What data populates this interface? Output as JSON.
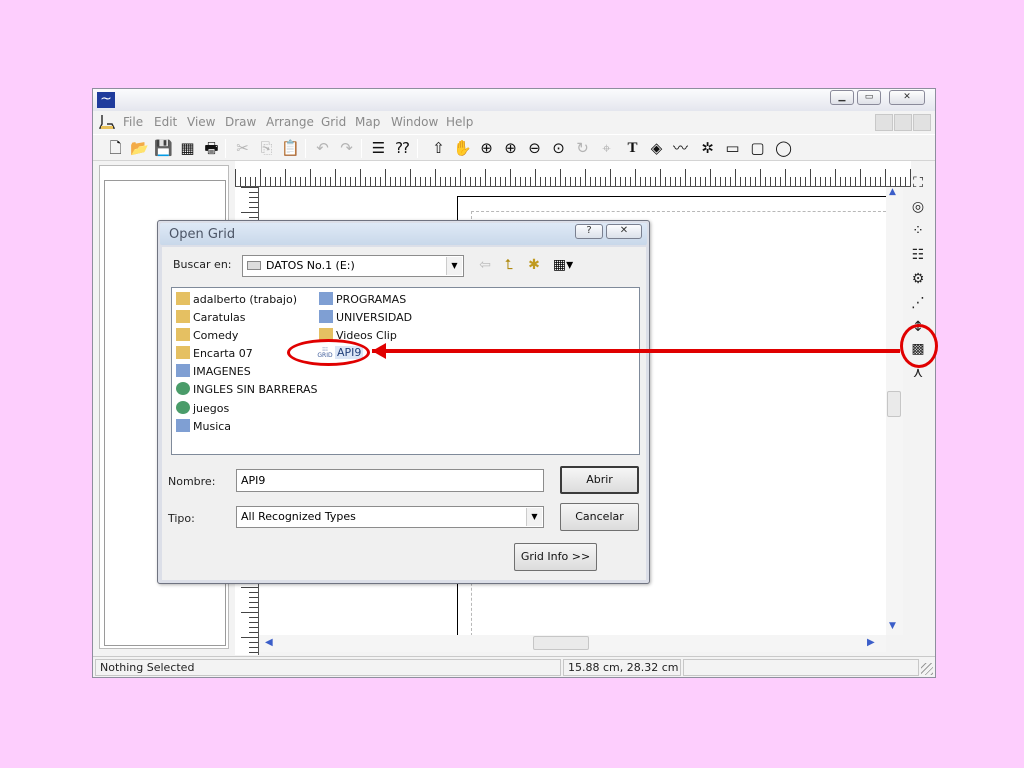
{
  "menu": {
    "items": [
      "File",
      "Edit",
      "View",
      "Draw",
      "Arrange",
      "Grid",
      "Map",
      "Window",
      "Help"
    ]
  },
  "status": {
    "message": "Nothing Selected",
    "coordinates": "15.88 cm, 28.32 cm"
  },
  "dialog": {
    "title": "Open Grid",
    "look_in_label": "Buscar en:",
    "look_in_value": "DATOS No.1 (E:)",
    "files_col1": [
      {
        "name": "adalberto (trabajo)",
        "icon": "folder-icon"
      },
      {
        "name": "Caratulas",
        "icon": "shared-folder-icon"
      },
      {
        "name": "Comedy",
        "icon": "folder-icon"
      },
      {
        "name": "Encarta 07",
        "icon": "folder-icon"
      },
      {
        "name": "IMAGENES",
        "icon": "shortcut-icon"
      },
      {
        "name": "INGLES SIN BARRERAS",
        "icon": "globe-icon"
      },
      {
        "name": "juegos",
        "icon": "globe-icon"
      },
      {
        "name": "Musica",
        "icon": "shortcut-icon"
      }
    ],
    "files_col2": [
      {
        "name": "PROGRAMAS",
        "icon": "shortcut-icon"
      },
      {
        "name": "UNIVERSIDAD",
        "icon": "shortcut-icon"
      },
      {
        "name": "Videos Clip",
        "icon": "folder-icon"
      }
    ],
    "selected_file": {
      "name": "API9",
      "icon_text": "GRID"
    },
    "name_label": "Nombre:",
    "name_value": "API9",
    "type_label": "Tipo:",
    "type_value": "All Recognized Types",
    "open_button": "Abrir",
    "cancel_button": "Cancelar",
    "grid_info_button": "Grid Info >>"
  },
  "colors": {
    "background": "#fdcefd",
    "annotation": "#e00000",
    "selection": "#dce6f6"
  }
}
